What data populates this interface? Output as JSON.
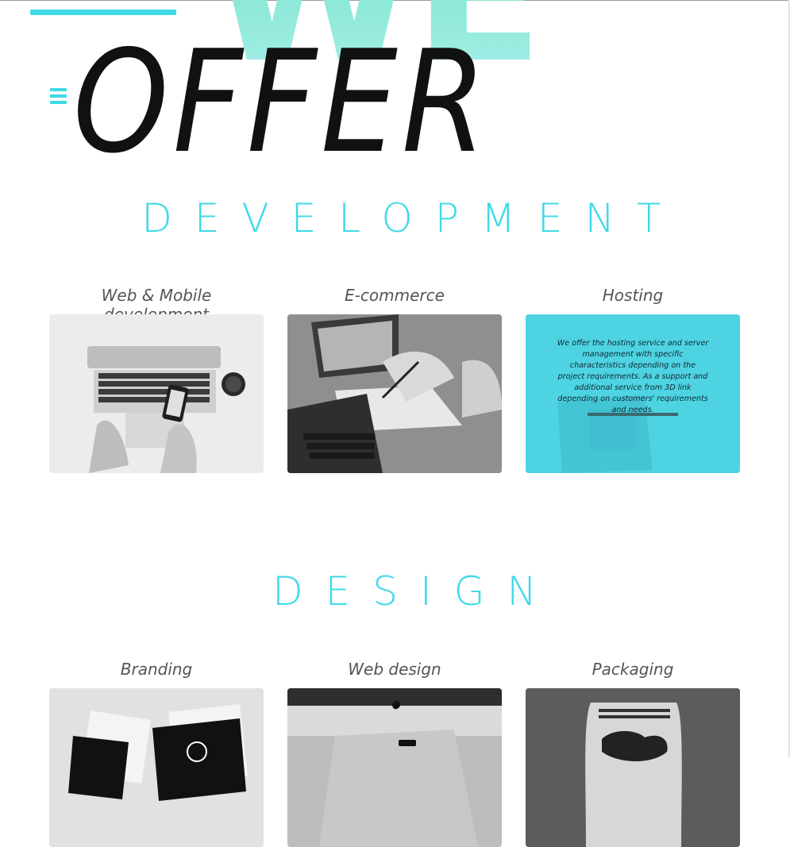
{
  "hero": {
    "we": "WE",
    "offer": "OFFER"
  },
  "sections": {
    "development": {
      "title": "DEVELOPMENT",
      "cards": [
        {
          "title": "Web & Mobile development",
          "image": "laptop-smartphone-photo"
        },
        {
          "title": "E-commerce",
          "image": "office-laptop-paperwork-photo"
        },
        {
          "title": "Hosting",
          "image": "hosting-photo",
          "overlay_text": "We offer the hosting service and server management with specific characteristics depending on the project requirements. As a support and additional service from 3D link depending on customers' requirements and needs."
        }
      ]
    },
    "design": {
      "title": "DESIGN",
      "cards": [
        {
          "title": "Branding",
          "image": "business-cards-photo"
        },
        {
          "title": "Web design",
          "image": "imac-desk-photo"
        },
        {
          "title": "Packaging",
          "image": "choco-packaging-photo"
        }
      ]
    }
  },
  "colors": {
    "accent": "#3fd9e8",
    "hosting_overlay": "#4ed3e2",
    "we_gradient": "#8ee8d8",
    "text": "#111111"
  },
  "icons": {
    "menu": "hamburger-menu-icon"
  }
}
